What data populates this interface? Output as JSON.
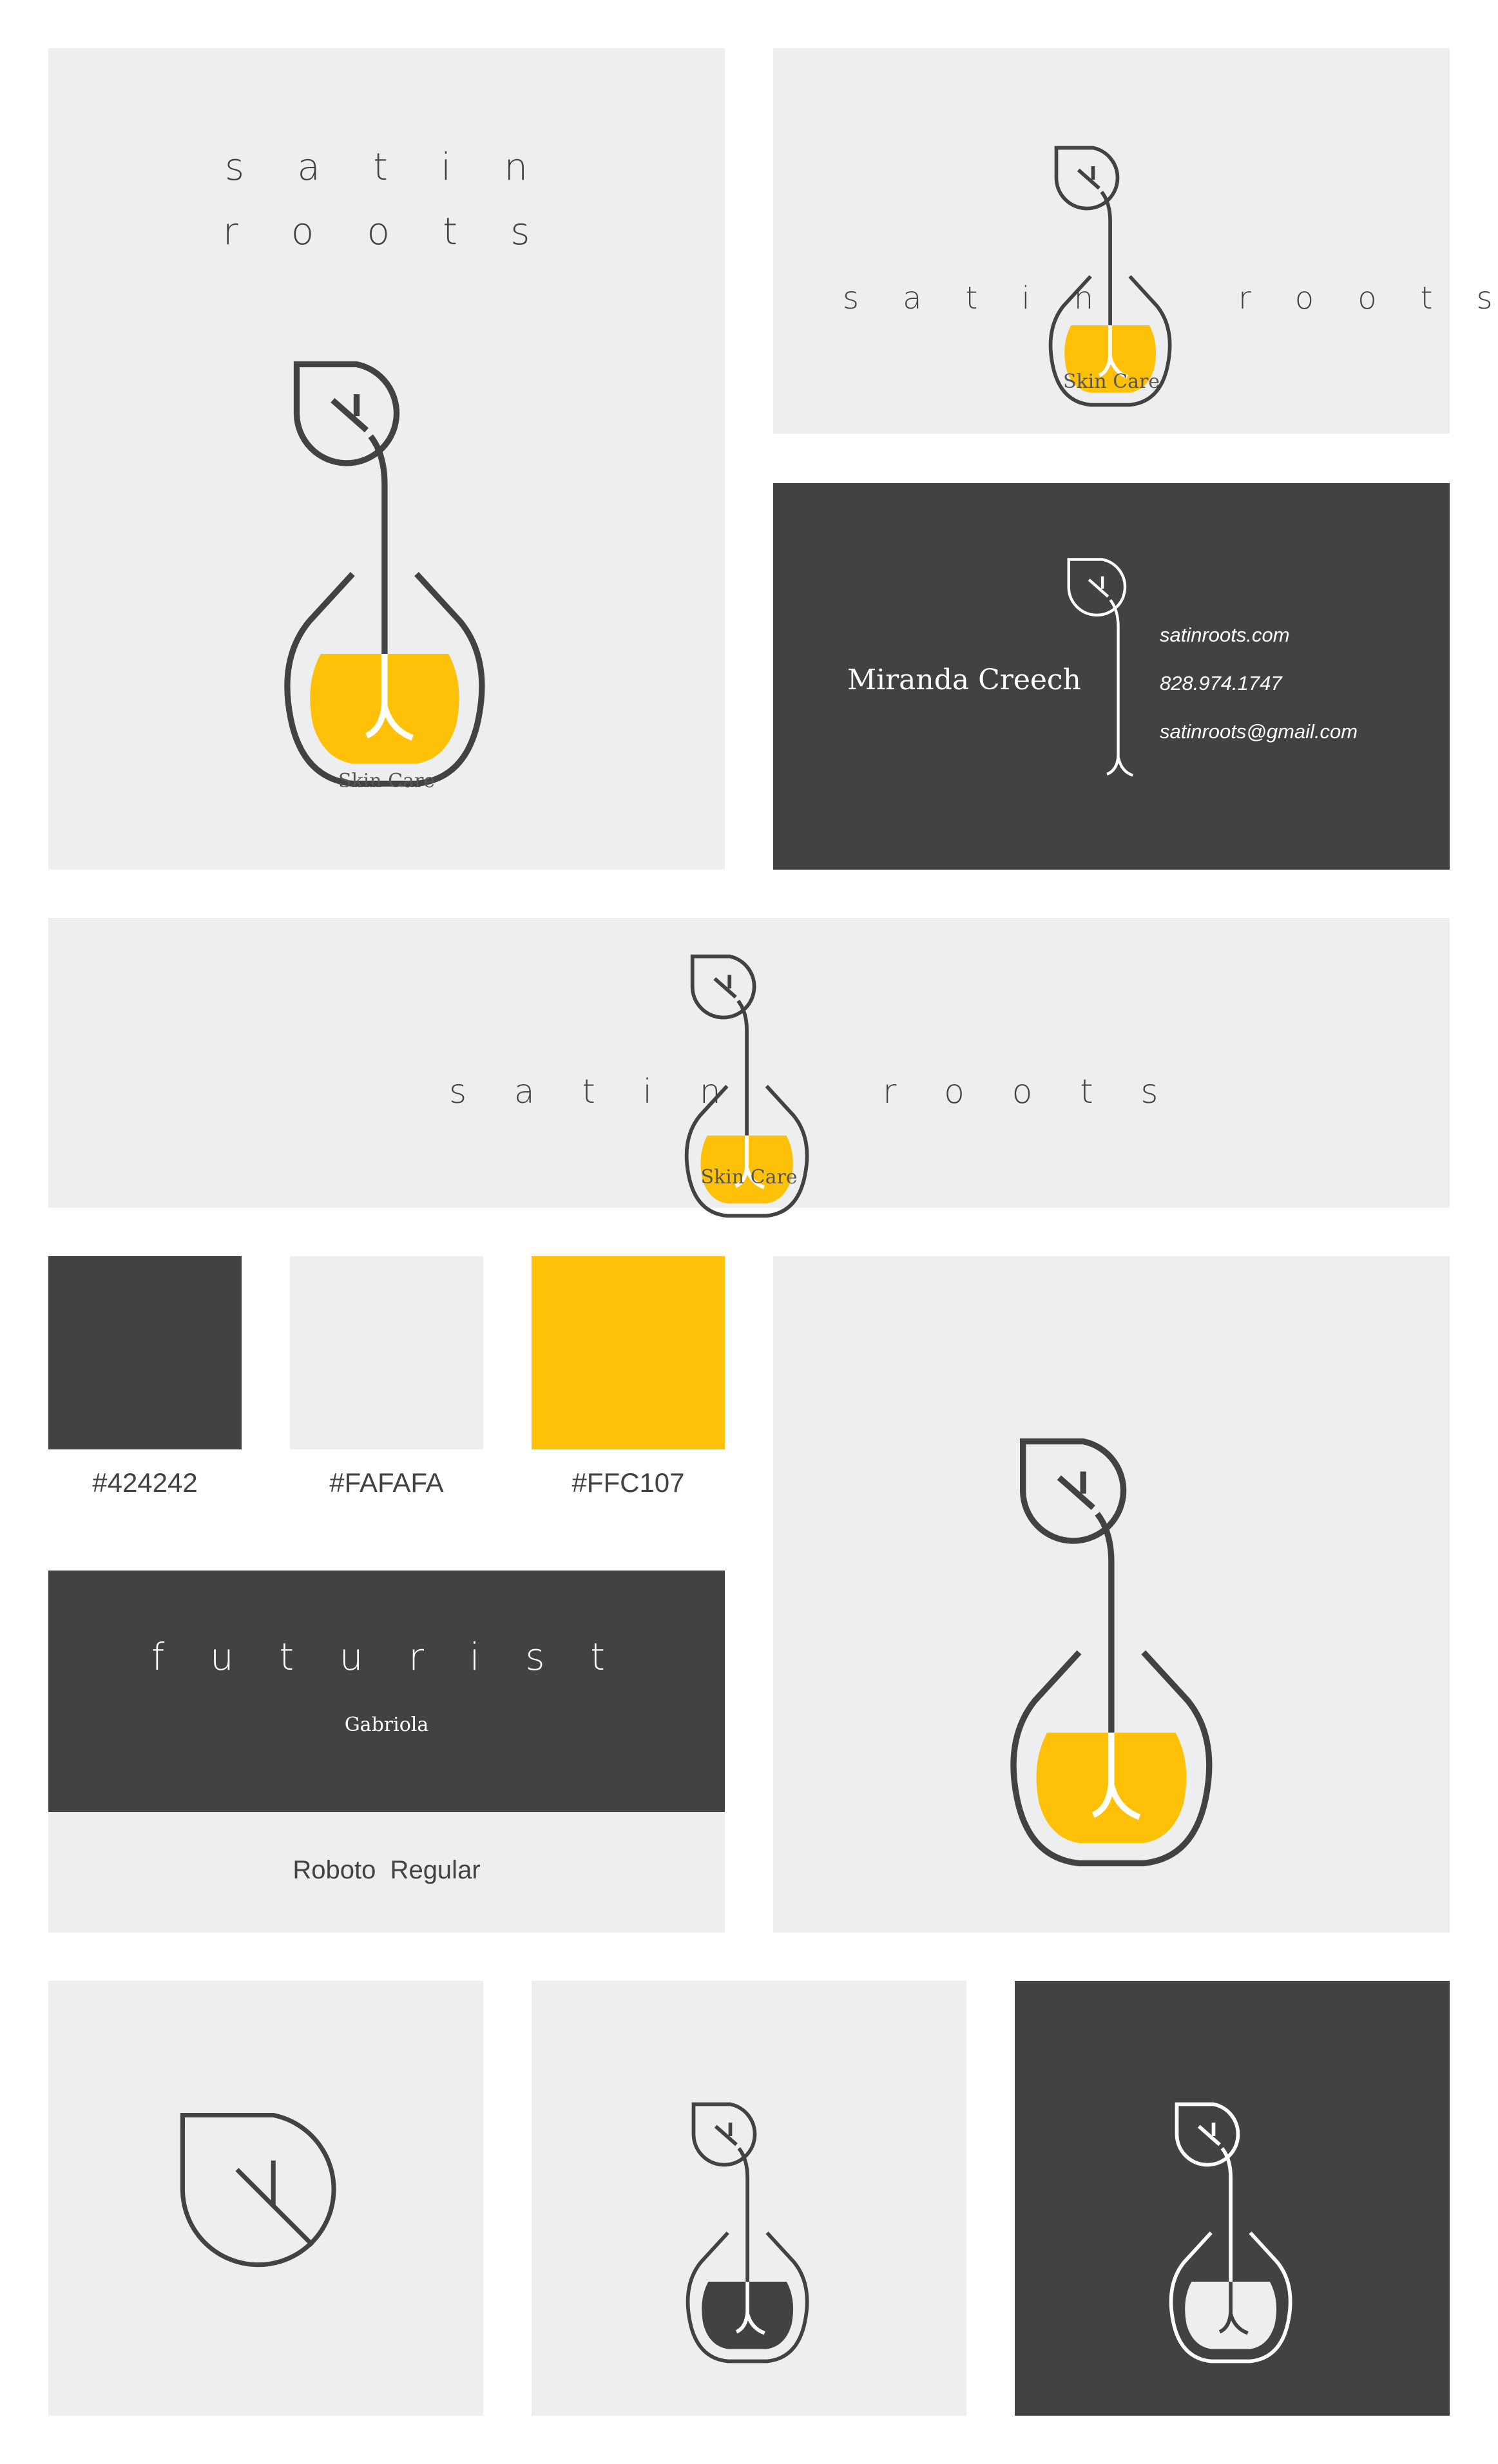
{
  "brand": {
    "word1": "s a t i n",
    "word2": "r o o t s",
    "tagline": "Skin Care"
  },
  "card": {
    "name": "Miranda Creech",
    "website": "satinroots.com",
    "phone": "828.974.1747",
    "email": "satinroots@gmail.com"
  },
  "palette": [
    {
      "hex": "#424242",
      "label": "#424242"
    },
    {
      "hex": "#FAFAFA",
      "label": "#FAFAFA"
    },
    {
      "hex": "#FFC107",
      "label": "#FFC107"
    }
  ],
  "typography": {
    "display_font": "f u t u r i s t",
    "secondary_font": "Gabriola",
    "body_font": "Roboto  Regular"
  },
  "colors": {
    "dark": "#424242",
    "light": "#eceef0",
    "accent": "#FFC107"
  }
}
